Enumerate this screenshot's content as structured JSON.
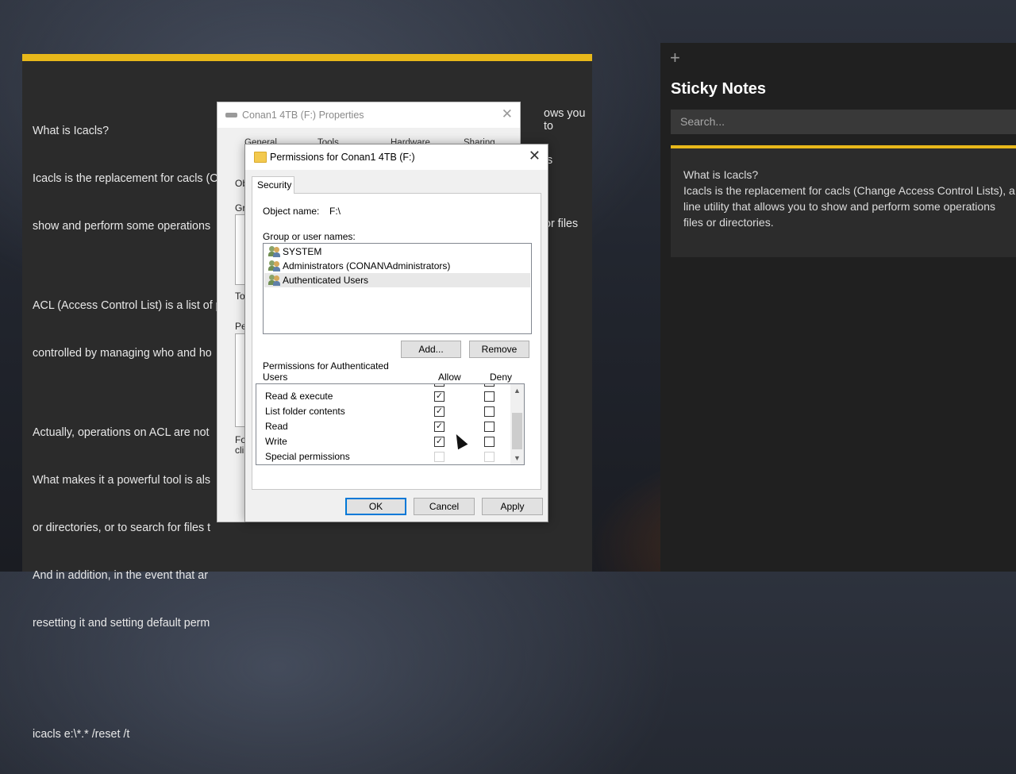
{
  "note": {
    "lines": [
      "What is Icacls?",
      "Icacls is the replacement for cacls (C",
      "show and perform some operations",
      "",
      "ACL (Access Control List) is a list of p",
      "controlled by managing who and ho",
      "",
      "Actually, operations on ACL are not",
      "What makes it a powerful tool is als",
      "or directories, or to search for files t",
      "And in addition, in the event that ar",
      "resetting it and setting default perm",
      "",
      "",
      "icacls e:\\*.* /reset /t"
    ],
    "right_fragments": [
      "ows you to",
      "s",
      "or files"
    ]
  },
  "sticky_notes": {
    "plus_icon": "+",
    "title": "Sticky Notes",
    "search_placeholder": "Search...",
    "card_text": "What is Icacls?\nIcacls is the replacement for cacls (Change Access Control Lists), a\nline utility that allows you to show and perform some operations\nfiles or directories.",
    "accent_color": "#e8b81a"
  },
  "properties_dialog": {
    "title": "Conan1 4TB (F:) Properties",
    "tabs": [
      "General",
      "Tools",
      "Hardware",
      "Sharing"
    ],
    "stubs": [
      "Ob",
      "Gr",
      "To",
      "Pe",
      "Fo",
      "cli"
    ]
  },
  "permissions_dialog": {
    "title": "Permissions for Conan1 4TB (F:)",
    "tab": "Security",
    "object_name_label": "Object name:",
    "object_name_value": "F:\\",
    "group_label": "Group or user names:",
    "users": [
      {
        "name": "SYSTEM",
        "selected": false
      },
      {
        "name": "Administrators (CONAN\\Administrators)",
        "selected": false
      },
      {
        "name": "Authenticated Users",
        "selected": true
      }
    ],
    "add_button": "Add...",
    "remove_button": "Remove",
    "permissions_label_line1": "Permissions for Authenticated",
    "permissions_label_line2": "Users",
    "allow_header": "Allow",
    "deny_header": "Deny",
    "permissions": [
      {
        "name": "Read & execute",
        "allow": true,
        "deny": false,
        "disabled": false
      },
      {
        "name": "List folder contents",
        "allow": true,
        "deny": false,
        "disabled": false
      },
      {
        "name": "Read",
        "allow": true,
        "deny": false,
        "disabled": false
      },
      {
        "name": "Write",
        "allow": true,
        "deny": false,
        "disabled": false
      },
      {
        "name": "Special permissions",
        "allow": false,
        "deny": false,
        "disabled": true
      }
    ],
    "ok_button": "OK",
    "cancel_button": "Cancel",
    "apply_button": "Apply",
    "check_glyph": "✓"
  }
}
